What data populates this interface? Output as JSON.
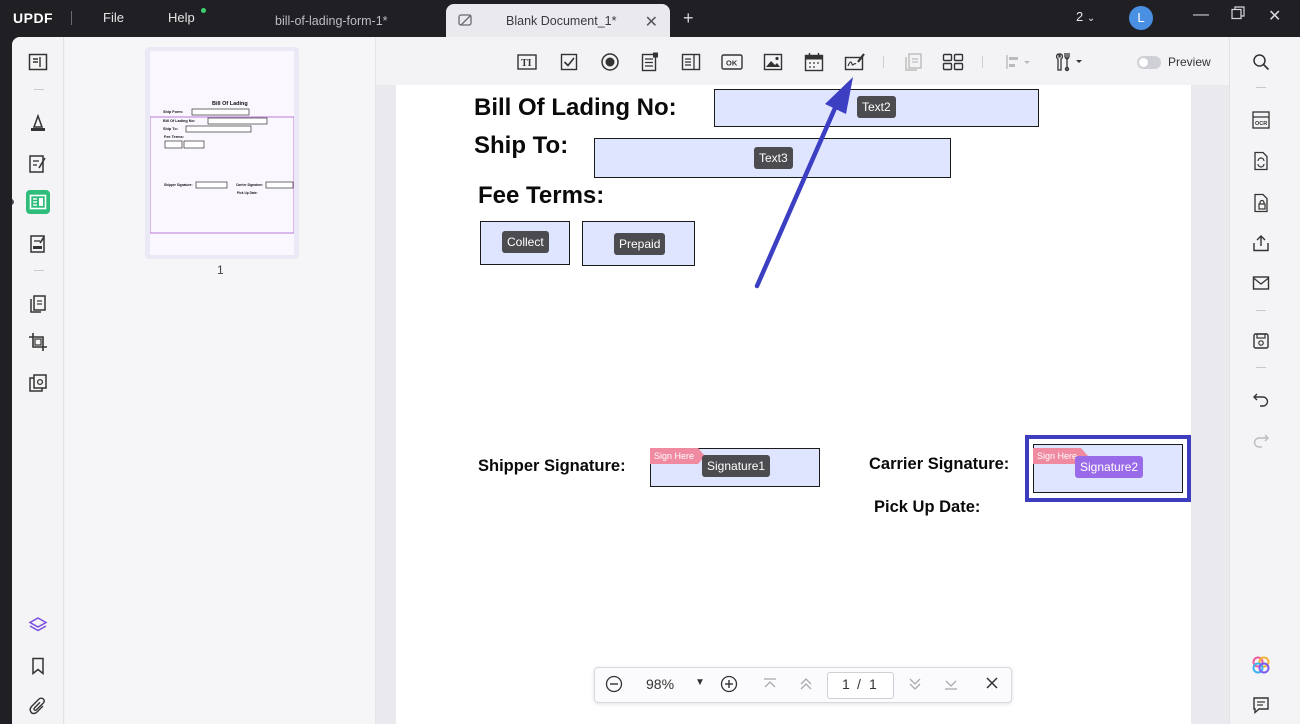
{
  "app": {
    "logo": "UPDF",
    "menu": {
      "file": "File",
      "help": "Help"
    },
    "tabs": [
      {
        "label": "bill-of-lading-form-1*",
        "active": false
      },
      {
        "label": "Blank Document_1*",
        "active": true
      }
    ],
    "window_count": "2",
    "avatar_initial": "L"
  },
  "toolbar": {
    "preview_label": "Preview",
    "tools": [
      "text-field-icon",
      "checkbox-icon",
      "radio-button-icon",
      "list-box-icon",
      "dropdown-icon",
      "button-ok-icon",
      "image-field-icon",
      "date-field-icon",
      "signature-field-icon",
      "duplicate-icon",
      "grid-icon",
      "align-icon",
      "tools-icon"
    ]
  },
  "thumbnail": {
    "page_number": "1",
    "mini": {
      "title": "Bill Of Lading",
      "ship_form": "Ship Form:",
      "bol_no": "Bill Of Lading No:",
      "ship_to": "Ship To:",
      "fee_terms": "Fee Terms:",
      "shipper_sig": "Shipper Signature:",
      "carrier_sig": "Carrier Signature:",
      "pickup": "Pick Up Date:"
    }
  },
  "document": {
    "bol_no_label": "Bill Of Lading No:",
    "ship_to_label": "Ship To:",
    "fee_terms_label": "Fee Terms:",
    "shipper_signature_label": "Shipper Signature:",
    "carrier_signature_label": "Carrier Signature:",
    "pickup_date_label": "Pick Up Date:",
    "fields": {
      "text2": "Text2",
      "text3": "Text3",
      "collect": "Collect",
      "prepaid": "Prepaid",
      "signature1": "Signature1",
      "signature2": "Signature2",
      "sign_here": "Sign Here"
    }
  },
  "zoom_bar": {
    "zoom": "98%",
    "current_page": "1",
    "separator": "/",
    "total_pages": "1"
  },
  "colors": {
    "accent_green": "#2ebd7a",
    "field_fill": "#dfe4ff",
    "selection_blue": "#3c3dbf",
    "sign_here_pink": "#f08aa0",
    "signature2_tag": "#9a6be8"
  }
}
